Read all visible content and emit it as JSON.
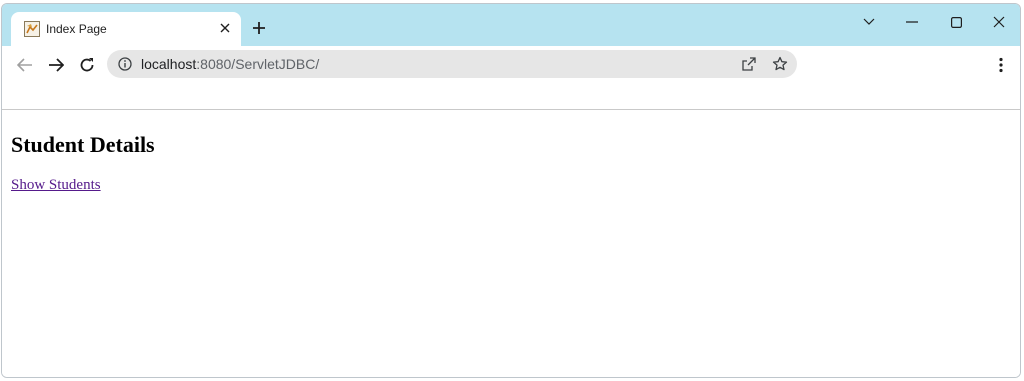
{
  "browser": {
    "tab": {
      "title": "Index Page",
      "favicon": "tomcat-icon"
    },
    "window_controls": [
      "chevron-down-icon",
      "minimize-icon",
      "maximize-icon",
      "close-icon"
    ],
    "address_bar": {
      "host": "localhost",
      "rest": ":8080/ServletJDBC/",
      "info_icon": "info-icon",
      "share_icon": "share-icon",
      "bookmark_icon": "star-icon"
    },
    "colors": {
      "titlebar": "#b6e3f0",
      "omnibox": "#e6e6e6",
      "visited_link": "#551a8b"
    }
  },
  "page": {
    "heading": "Student Details",
    "link_label": "Show Students"
  }
}
